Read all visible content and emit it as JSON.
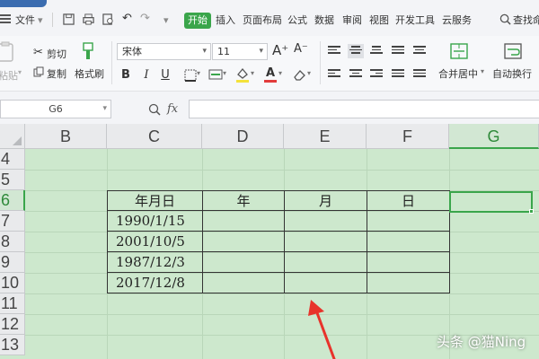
{
  "menubar": {
    "file_menu": "文件",
    "tabs": [
      "开始",
      "插入",
      "页面布局",
      "公式",
      "数据",
      "审阅",
      "视图",
      "开发工具",
      "云服务"
    ],
    "search": "查找命",
    "accent_color": "#3aa54b",
    "quick_access_icons": [
      "save-icon",
      "print-icon",
      "print-preview-icon",
      "undo-icon",
      "redo-icon",
      "customize-icon"
    ]
  },
  "ribbon": {
    "paste": "粘贴",
    "cut": "剪切",
    "copy": "复制",
    "format_painter": "格式刷",
    "font_name": "宋体",
    "font_size": "11",
    "increase_font": "A⁺",
    "decrease_font": "A⁻",
    "bold": "B",
    "italic": "I",
    "underline": "U",
    "merge_center": "合并居中",
    "auto_wrap": "自动换行"
  },
  "formula_bar": {
    "name_box": "G6",
    "fx": "fx",
    "value": ""
  },
  "sheet": {
    "columns": [
      "B",
      "C",
      "D",
      "E",
      "F",
      "G"
    ],
    "selected_column": "G",
    "rows": [
      "4",
      "5",
      "6",
      "7",
      "8",
      "9",
      "10",
      "11",
      "12",
      "13"
    ],
    "selected_row": "6",
    "table": {
      "headers": [
        "年月日",
        "年",
        "月",
        "日"
      ],
      "rows": [
        [
          "1990/1/15",
          "",
          "",
          ""
        ],
        [
          "2001/10/5",
          "",
          "",
          ""
        ],
        [
          "1987/12/3",
          "",
          "",
          ""
        ],
        [
          "2017/12/8",
          "",
          "",
          ""
        ]
      ]
    },
    "background_color": "#cde8cd",
    "selected_cell": "G6"
  },
  "watermark": "头条 @猫Ning"
}
